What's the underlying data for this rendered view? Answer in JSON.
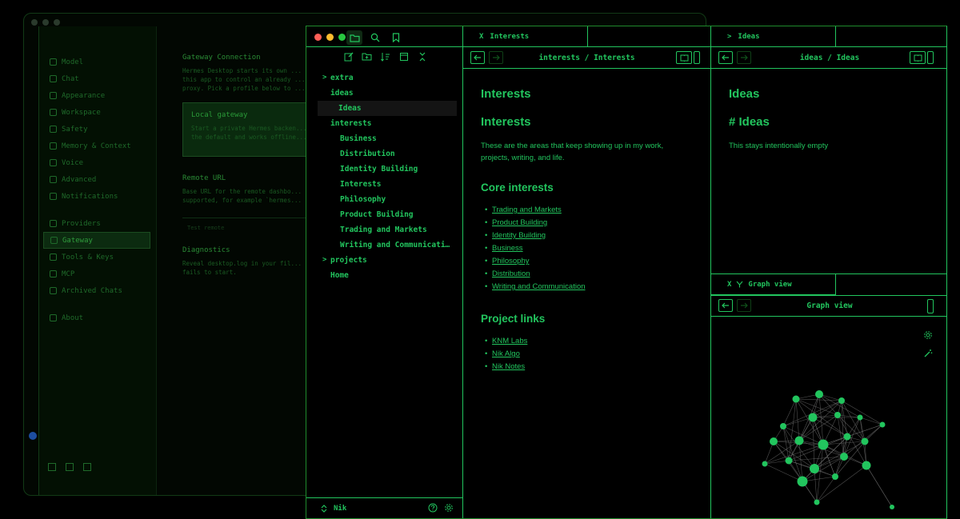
{
  "background_window": {
    "sidebar": {
      "items": [
        {
          "label": "Model",
          "icon": "model-icon"
        },
        {
          "label": "Chat",
          "icon": "chat-icon"
        },
        {
          "label": "Appearance",
          "icon": "appearance-icon"
        },
        {
          "label": "Workspace",
          "icon": "workspace-icon"
        },
        {
          "label": "Safety",
          "icon": "safety-icon"
        },
        {
          "label": "Memory & Context",
          "icon": "memory-icon"
        },
        {
          "label": "Voice",
          "icon": "voice-icon"
        },
        {
          "label": "Advanced",
          "icon": "advanced-icon"
        },
        {
          "label": "Notifications",
          "icon": "bell-icon"
        }
      ],
      "items2": [
        {
          "label": "Providers",
          "icon": "providers-icon"
        },
        {
          "label": "Gateway",
          "icon": "gateway-icon",
          "active": true
        },
        {
          "label": "Tools & Keys",
          "icon": "key-icon"
        },
        {
          "label": "MCP",
          "icon": "mcp-icon"
        },
        {
          "label": "Archived Chats",
          "icon": "archive-icon"
        }
      ],
      "items3": [
        {
          "label": "About",
          "icon": "info-icon"
        }
      ]
    },
    "main": {
      "title": "Gateway Connection",
      "intro": [
        "Hermes Desktop starts its own ...",
        "this app to control an already ...",
        "proxy. Pick a profile below to ..."
      ],
      "card_title": "Local gateway",
      "card_lines": [
        "Start a private Hermes backen...",
        "the default and works offline..."
      ],
      "remote_title": "Remote URL",
      "remote_lines": [
        "Base URL for the remote dashbo...",
        "supported, for example `hermes..."
      ],
      "remote_placeholder": "Test remote",
      "diag_title": "Diagnostics",
      "diag_lines": [
        "Reveal desktop.log in your fil...",
        "fails to start."
      ]
    }
  },
  "explorer": {
    "tree": [
      {
        "label": "extra",
        "kind": "folder-collapsed"
      },
      {
        "label": "ideas",
        "kind": "folder"
      },
      {
        "label": "Ideas",
        "kind": "child",
        "selected": true
      },
      {
        "label": "interests",
        "kind": "folder"
      },
      {
        "label": "Business",
        "kind": "child"
      },
      {
        "label": "Distribution",
        "kind": "child"
      },
      {
        "label": "Identity Building",
        "kind": "child"
      },
      {
        "label": "Interests",
        "kind": "child"
      },
      {
        "label": "Philosophy",
        "kind": "child"
      },
      {
        "label": "Product Building",
        "kind": "child"
      },
      {
        "label": "Trading and Markets",
        "kind": "child"
      },
      {
        "label": "Writing and Communicati…",
        "kind": "child"
      },
      {
        "label": "projects",
        "kind": "folder-collapsed"
      },
      {
        "label": "Home",
        "kind": "folder"
      }
    ],
    "vault_name": "Nik"
  },
  "interests_pane": {
    "tab_close": "X",
    "tab_label": "Interests",
    "breadcrumb": "interests / Interests",
    "h1": "Interests",
    "h1b": "Interests",
    "intro": "These are the areas that keep showing up in my work, projects, writing, and life.",
    "core_heading": "Core interests",
    "core_links": [
      "Trading and Markets",
      "Product Building",
      "Identity Building",
      "Business",
      "Philosophy",
      "Distribution",
      "Writing and Communication"
    ],
    "project_heading": "Project links",
    "project_links": [
      "KNM Labs",
      "Nik Algo",
      "Nik Notes"
    ]
  },
  "ideas_pane": {
    "tab_chevron": ">",
    "tab_label": "Ideas",
    "breadcrumb": "ideas / Ideas",
    "h1": "Ideas",
    "h1b": "# Ideas",
    "body": "This stays intentionally empty"
  },
  "graph_pane": {
    "tab_close": "X",
    "tab_label": "Graph view",
    "title": "Graph view"
  },
  "colors": {
    "accent": "#22c55e",
    "background": "#000000",
    "traffic_red": "#ff5f57",
    "traffic_yellow": "#febc2e",
    "traffic_green": "#28c840"
  }
}
